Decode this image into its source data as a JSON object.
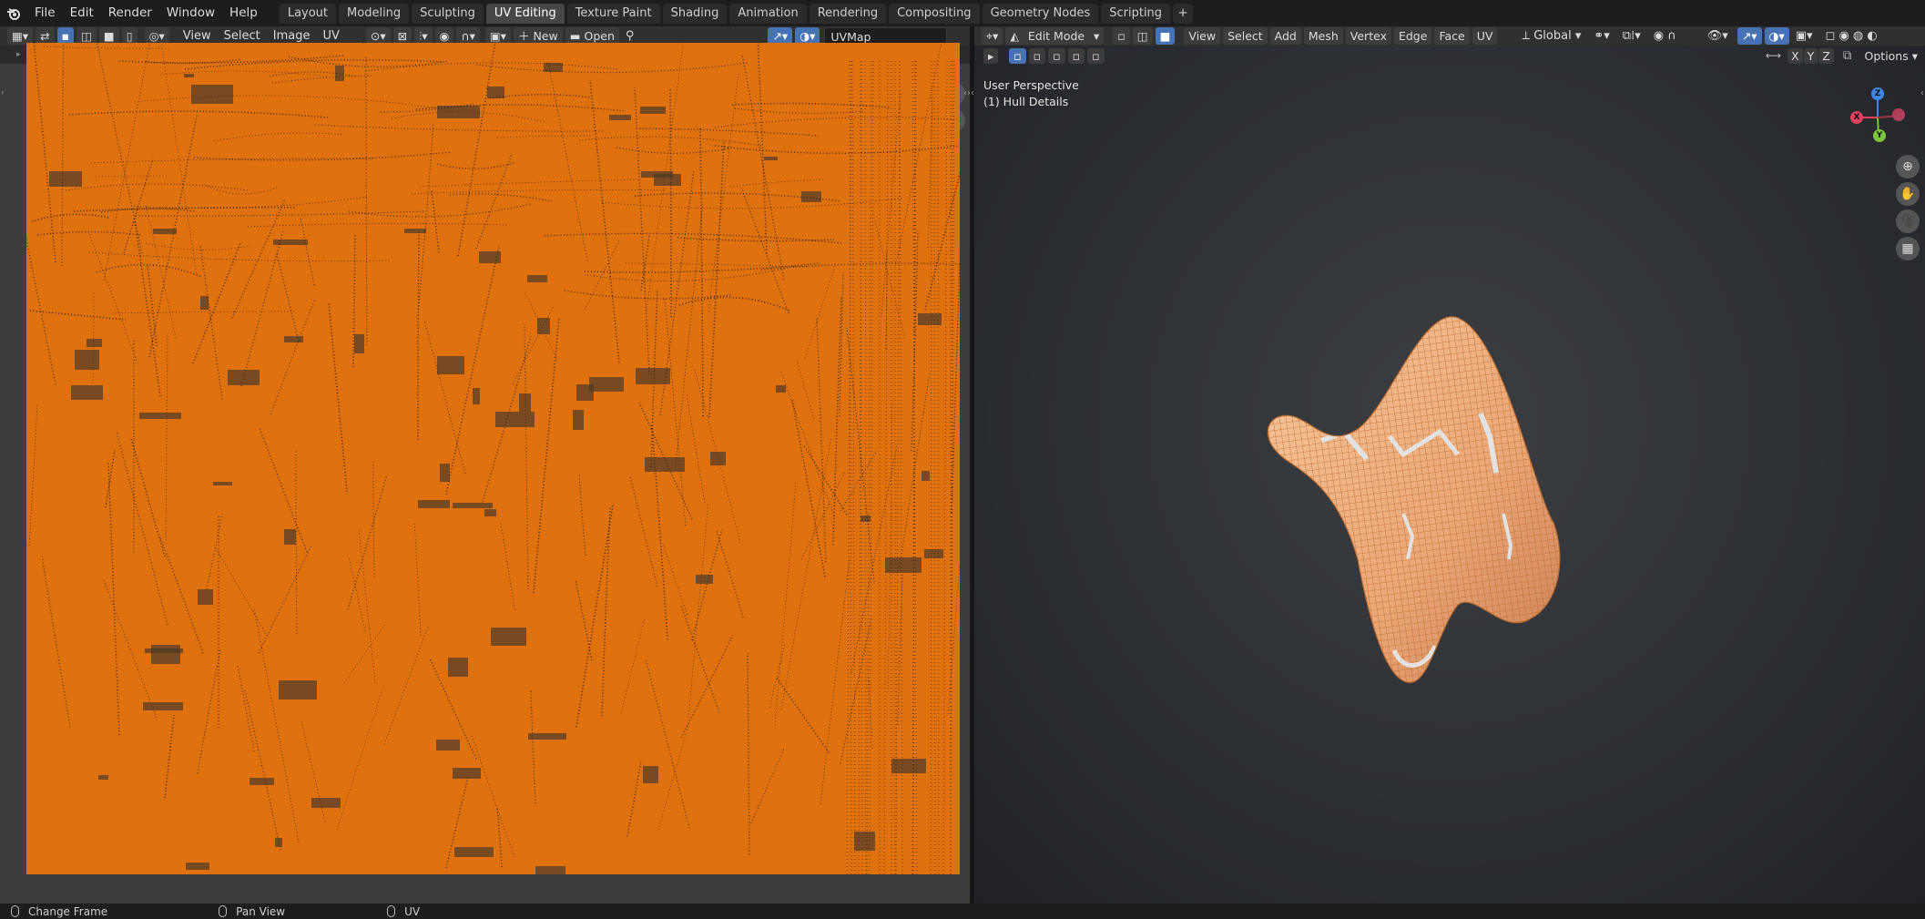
{
  "menu": {
    "file": "File",
    "edit": "Edit",
    "render": "Render",
    "window": "Window",
    "help": "Help"
  },
  "workspaces": {
    "active": "UV Editing",
    "tabs": [
      "Layout",
      "Modeling",
      "Sculpting",
      "UV Editing",
      "Texture Paint",
      "Shading",
      "Animation",
      "Rendering",
      "Compositing",
      "Geometry Nodes",
      "Scripting"
    ]
  },
  "uv_editor": {
    "menus": {
      "view": "View",
      "select": "Select",
      "image": "Image",
      "uv": "UV"
    },
    "new_label": "New",
    "open_label": "Open",
    "uvmap_value": "UVMap"
  },
  "viewport": {
    "mode": "Edit Mode",
    "menus": {
      "view": "View",
      "select": "Select",
      "add": "Add",
      "mesh": "Mesh",
      "vertex": "Vertex",
      "edge": "Edge",
      "face": "Face",
      "uv": "UV"
    },
    "orientation": "Global",
    "axis_x": "X",
    "axis_y": "Y",
    "axis_z": "Z",
    "options": "Options",
    "perspective_label": "User Perspective",
    "object_label": "(1) Hull Details"
  },
  "status_bar": {
    "left": "Change Frame",
    "middle": "Pan View",
    "right": "UV"
  },
  "colors": {
    "accent": "#4772b3",
    "uv_orange": "#e0710f",
    "vertex_select": "#ff8a1c"
  }
}
